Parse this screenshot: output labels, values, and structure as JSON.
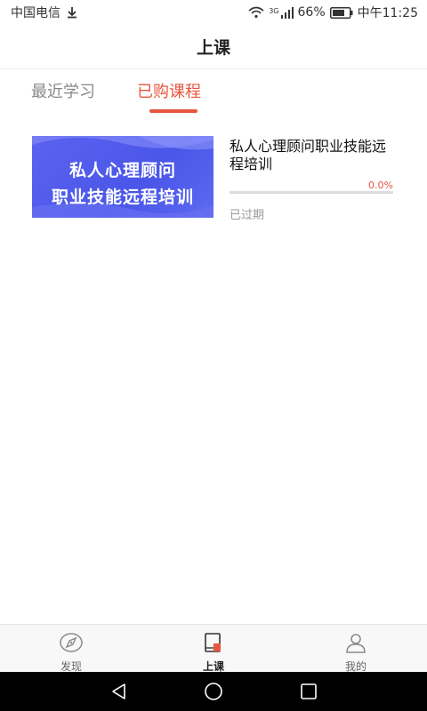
{
  "status_bar": {
    "carrier": "中国电信",
    "network": "3G",
    "battery": "66%",
    "time": "中午11:25",
    "icons": [
      "download-icon",
      "wifi-icon",
      "signal-icon",
      "battery-icon"
    ]
  },
  "header": {
    "title": "上课"
  },
  "tabs": [
    {
      "label": "最近学习",
      "active": false
    },
    {
      "label": "已购课程",
      "active": true
    }
  ],
  "course": {
    "thumbnail_lines": [
      "私人心理顾问",
      "职业技能远程培训"
    ],
    "title": "私人心理顾问职业技能远程培训",
    "progress_text": "0.0%",
    "progress_value": 0.0,
    "status": "已过期"
  },
  "bottom_nav": [
    {
      "label": "发现",
      "icon": "compass-icon",
      "active": false
    },
    {
      "label": "上课",
      "icon": "book-icon",
      "active": true
    },
    {
      "label": "我的",
      "icon": "user-icon",
      "active": false
    }
  ],
  "system_nav": {
    "icons": [
      "back-icon",
      "home-icon",
      "recent-apps-icon"
    ]
  },
  "colors": {
    "accent": "#e8553e",
    "thumb_blue": "#4a56e8",
    "muted": "#999999"
  }
}
